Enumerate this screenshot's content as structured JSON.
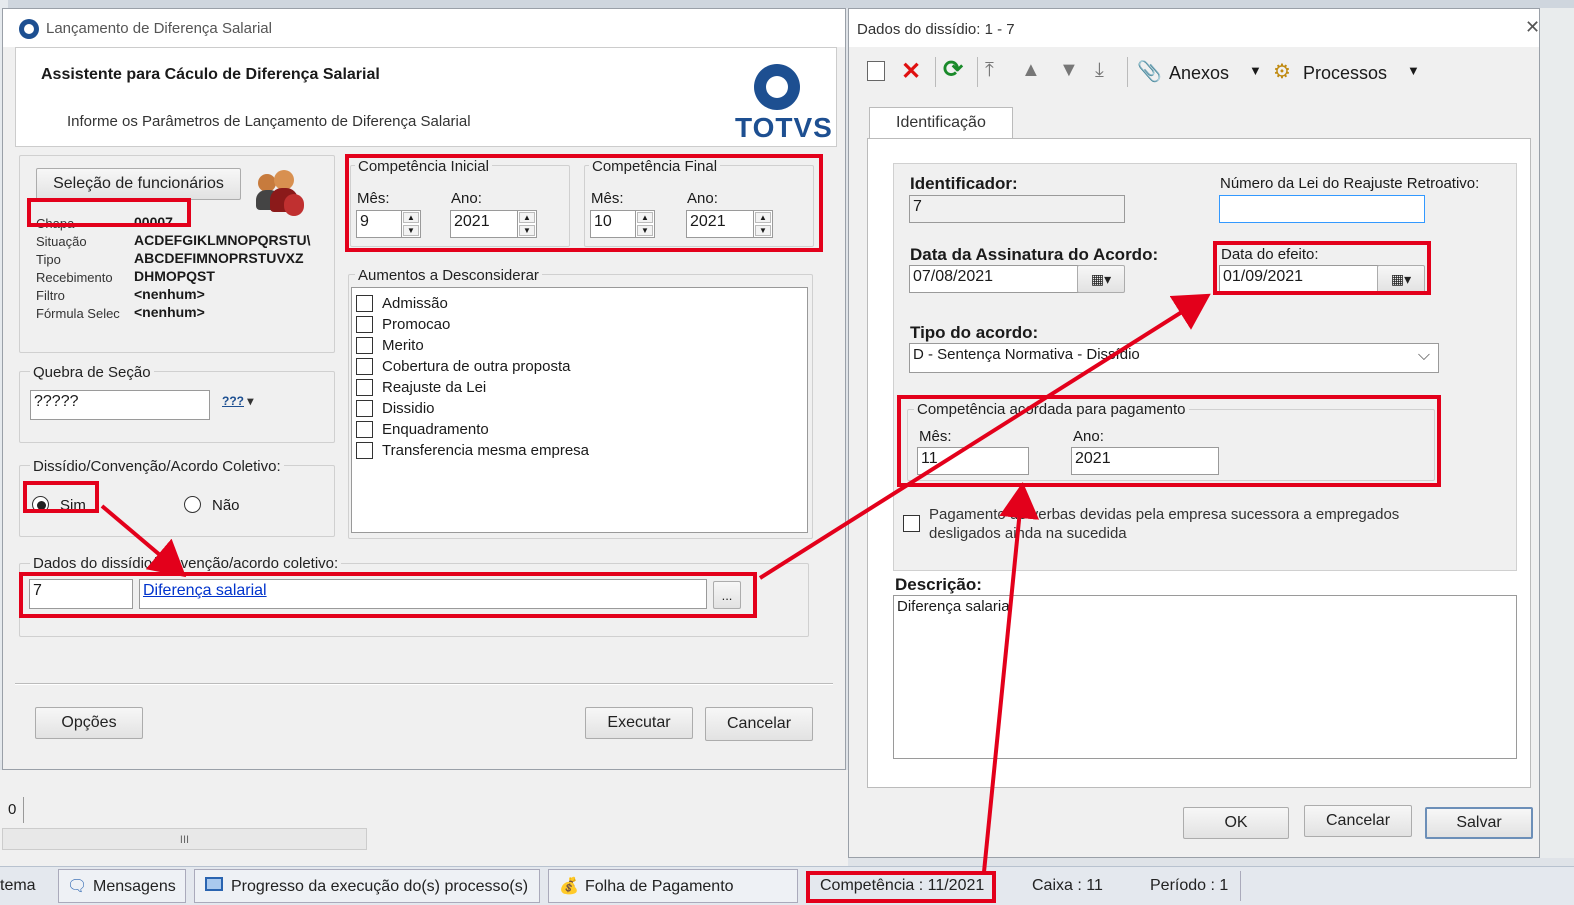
{
  "left": {
    "title": "Lançamento de Diferença Salarial",
    "heading": "Assistente para Cáculo de Diferença Salarial",
    "subheading": "Informe os Parâmetros de Lançamento de Diferença Salarial",
    "brand": "TOTVS",
    "sel_button": "Seleção de funcionários",
    "info": [
      {
        "k": "Chapa",
        "v": "00007"
      },
      {
        "k": "Situação",
        "v": "ACDEFGIKLMNOPQRSTU\\"
      },
      {
        "k": "Tipo",
        "v": "ABCDEFIMNOPRSTUVXZ"
      },
      {
        "k": "Recebimento",
        "v": "DHMOPQST"
      },
      {
        "k": "Filtro",
        "v": "<nenhum>"
      },
      {
        "k": "Fórmula Selec",
        "v": "<nenhum>"
      }
    ],
    "comp_inicial": {
      "legend": "Competência Inicial",
      "mes_label": "Mês:",
      "mes": "9",
      "ano_label": "Ano:",
      "ano": "2021"
    },
    "comp_final": {
      "legend": "Competência Final",
      "mes_label": "Mês:",
      "mes": "10",
      "ano_label": "Ano:",
      "ano": "2021"
    },
    "aumentos": {
      "legend": "Aumentos a Desconsiderar",
      "items": [
        "Admissão",
        "Promocao",
        "Merito",
        "Cobertura de outra proposta",
        "Reajuste da Lei",
        "Dissidio",
        "Enquadramento",
        "Transferencia mesma empresa"
      ]
    },
    "quebra": {
      "legend": "Quebra de Seção",
      "value": "?????",
      "icon": "???"
    },
    "dissidio": {
      "legend": "Dissídio/Convenção/Acordo Coletivo:",
      "sim": "Sim",
      "nao": "Não"
    },
    "dados": {
      "legend": "Dados do dissídio/convenção/acordo coletivo:",
      "code": "7",
      "link": "Diferença salarial",
      "browse": "..."
    },
    "buttons": {
      "opcoes": "Opções",
      "executar": "Executar",
      "cancelar": "Cancelar"
    }
  },
  "right": {
    "title": "Dados do dissídio: 1 - 7",
    "toolbar": {
      "anexos": "Anexos",
      "processos": "Processos"
    },
    "tab": "Identificação",
    "identificador_label": "Identificador:",
    "identificador": "7",
    "lei_label": "Número da Lei do Reajuste Retroativo:",
    "lei": "",
    "data_ass_label": "Data da Assinatura do Acordo:",
    "data_ass": "07/08/2021",
    "data_efeito_label": "Data do efeito:",
    "data_efeito": "01/09/2021",
    "tipo_label": "Tipo do acordo:",
    "tipo": "D - Sentença Normativa - Dissídio",
    "comp_legend": "Competência acordada para pagamento",
    "mes_label": "Mês:",
    "mes": "11",
    "ano_label": "Ano:",
    "ano": "2021",
    "pagamento_text": "Pagamento de verbas devidas pela empresa sucessora a empregados desligados ainda na sucedida",
    "descricao_label": "Descrição:",
    "descricao": "Diferença salarial",
    "buttons": {
      "ok": "OK",
      "cancelar": "Cancelar",
      "salvar": "Salvar"
    }
  },
  "bg": {
    "field": "0",
    "scroll": "III"
  },
  "taskbar": {
    "sistema": "tema",
    "mensagens": "Mensagens",
    "progresso": "Progresso da execução do(s) processo(s)",
    "folha": "Folha de Pagamento",
    "competencia": "Competência : 11/2021",
    "caixa": "Caixa : 11",
    "periodo": "Período : 1"
  },
  "colors": {
    "accent_red": "#e3001b",
    "totvs_blue": "#1d4f91",
    "link": "#0033cc"
  }
}
